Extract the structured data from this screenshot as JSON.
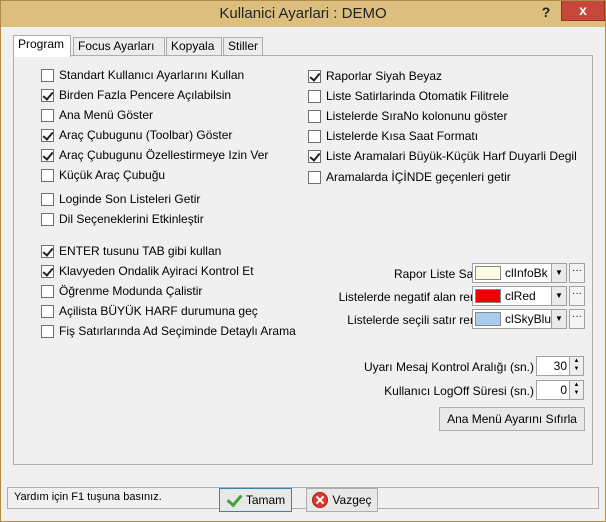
{
  "window": {
    "title": "Kullanici Ayarlari : DEMO",
    "help_label": "?",
    "close_label": "x"
  },
  "tabs": [
    {
      "label": "Program",
      "active": true
    },
    {
      "label": "Focus Ayarları",
      "active": false
    },
    {
      "label": "Kopyala",
      "active": false
    },
    {
      "label": "Stiller",
      "active": false
    }
  ],
  "left_options": [
    {
      "label": "Standart Kullanıcı Ayarlarını Kullan",
      "checked": false
    },
    {
      "label": "Birden Fazla Pencere Açılabilsin",
      "checked": true
    },
    {
      "label": "Ana Menü Göster",
      "checked": false
    },
    {
      "label": "Araç Çubugunu (Toolbar) Göster",
      "checked": true
    },
    {
      "label": "Araç Çubugunu Özellestirmeye Izin Ver",
      "checked": true
    },
    {
      "label": "Küçük Araç Çubuğu",
      "checked": false
    },
    {
      "label": "Loginde Son Listeleri Getir",
      "checked": false
    },
    {
      "label": "Dil Seçeneklerini Etkinleştir",
      "checked": false
    }
  ],
  "left_options_2": [
    {
      "label": "ENTER tusunu TAB gibi kullan",
      "checked": true
    },
    {
      "label": "Klavyeden Ondalik Ayiraci Kontrol Et",
      "checked": true
    },
    {
      "label": "Öğrenme Modunda Çalistir",
      "checked": false
    },
    {
      "label": "Açilista BÜYÜK HARF durumuna geç",
      "checked": false
    },
    {
      "label": "Fiş Satırlarında Ad Seçiminde Detaylı Arama",
      "checked": false
    }
  ],
  "right_options": [
    {
      "label": "Raporlar Siyah Beyaz",
      "checked": true
    },
    {
      "label": "Liste Satirlarinda Otomatik Filitrele",
      "checked": false
    },
    {
      "label": "Listelerde SıraNo kolonunu göster",
      "checked": false
    },
    {
      "label": "Listelerde Kısa Saat Formatı",
      "checked": false
    },
    {
      "label": "Liste Aramalari Büyük-Küçük Harf Duyarli Degil",
      "checked": true
    },
    {
      "label": "Aramalarda İÇİNDE geçenleri getir",
      "checked": false
    }
  ],
  "colors": [
    {
      "label": "Rapor Liste Satiri",
      "value": "clInfoBk",
      "hex": "#fffbe2"
    },
    {
      "label": "Listelerde negatif alan rengi",
      "value": "clRed",
      "hex": "#ee0000"
    },
    {
      "label": "Listelerde seçili satır rengi",
      "value": "clSkyBlue",
      "hex": "#a8cbf0"
    }
  ],
  "spinners": [
    {
      "label": "Uyarı Mesaj Kontrol Aralığı (sn.)",
      "value": "30"
    },
    {
      "label": "Kullanıcı LogOff Süresi (sn.)",
      "value": "0"
    }
  ],
  "reset_button": "Ana Menü Ayarını Sıfırla",
  "status": "Yardım için F1 tuşuna basınız.",
  "ok_button": "Tamam",
  "cancel_button": "Vazgeç"
}
